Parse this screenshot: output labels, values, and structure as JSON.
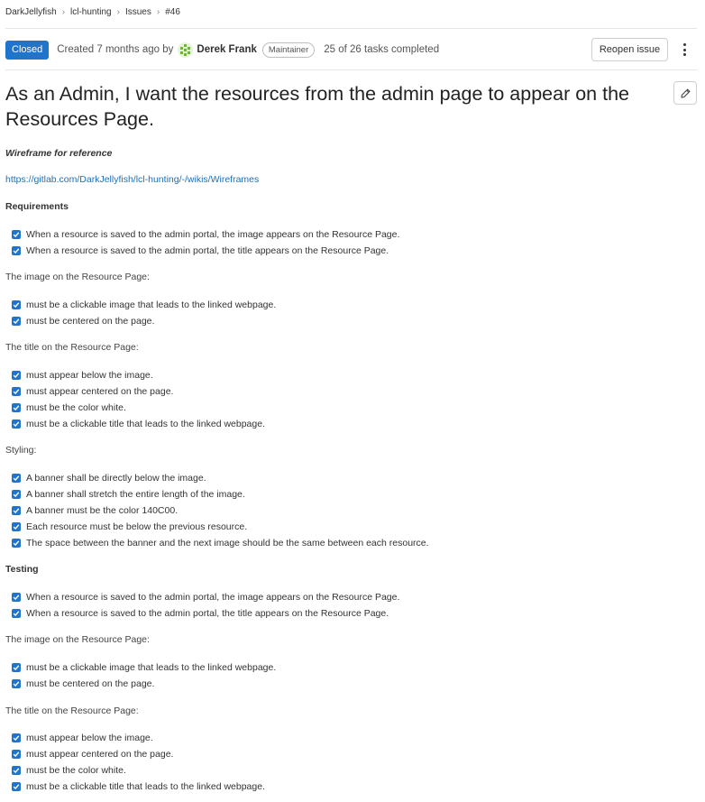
{
  "breadcrumb": [
    "DarkJellyfish",
    "lcl-hunting",
    "Issues",
    "#46"
  ],
  "status": {
    "badge": "Closed",
    "created": "Created 7 months ago by",
    "author": "Derek Frank",
    "role": "Maintainer",
    "tasks": "25 of 26 tasks completed"
  },
  "actions": {
    "reopen": "Reopen issue"
  },
  "issue_title": "As an Admin, I want the resources from the admin page to appear on the Resources Page.",
  "body": {
    "wireframe_heading": "Wireframe for reference",
    "wireframe_link": "https://gitlab.com/DarkJellyfish/lcl-hunting/-/wikis/Wireframes",
    "requirements_heading": "Requirements",
    "req_tasks": [
      "When a resource is saved to the admin portal, the image appears on the Resource Page.",
      "When a resource is saved to the admin portal, the title appears on the Resource Page."
    ],
    "req_image_heading": "The image on the Resource Page:",
    "req_image_tasks": [
      "must be a clickable image that leads to the linked webpage.",
      "must be centered on the page."
    ],
    "req_title_heading": "The title on the Resource Page:",
    "req_title_tasks": [
      "must appear below the image.",
      "must appear centered on the page.",
      "must be the color white.",
      "must be a clickable title that leads to the linked webpage."
    ],
    "styling_heading": "Styling:",
    "styling_tasks": [
      "A banner shall be directly below the image.",
      "A banner shall stretch the entire length of the image.",
      "A banner must be the color 140C00.",
      "Each resource must be below the previous resource.",
      "The space between the banner and the next image should be the same between each resource."
    ],
    "testing_heading": "Testing",
    "test_tasks": [
      "When a resource is saved to the admin portal, the image appears on the Resource Page.",
      "When a resource is saved to the admin portal, the title appears on the Resource Page."
    ],
    "test_image_heading": "The image on the Resource Page:",
    "test_image_tasks": [
      "must be a clickable image that leads to the linked webpage.",
      "must be centered on the page."
    ],
    "test_title_heading": "The title on the Resource Page:",
    "test_title_tasks": [
      "must appear below the image.",
      "must appear centered on the page.",
      "must be the color white.",
      "must be a clickable title that leads to the linked webpage."
    ]
  },
  "icons": [
    "chevron-right-icon",
    "avatar-identicon",
    "kebab-menu-icon",
    "pencil-icon",
    "checkbox-checked-icon"
  ],
  "colors": {
    "accent": "#1f75cb",
    "link": "#1f6fb8"
  }
}
